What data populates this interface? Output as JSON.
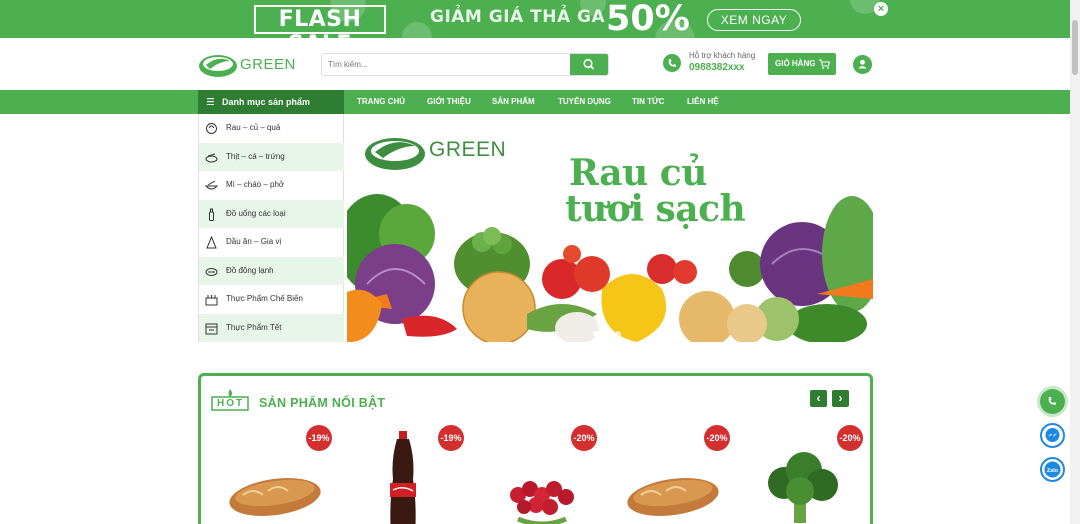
{
  "promo": {
    "flash_label": "FLASH SALE",
    "text": "GIẢM GIÁ THẢ GA",
    "percent": "50%",
    "button": "XEM NGAY",
    "close": "×",
    "colors": {
      "bg": "#4caf50"
    }
  },
  "header": {
    "logo_text": "GREEN",
    "search_placeholder": "Tìm kiếm...",
    "support_label": "Hỗ trợ khách hàng",
    "support_phone": "0988382xxx",
    "cart_label": "GIỎ HÀNG"
  },
  "nav": {
    "category_header": "Danh mục sản phẩm",
    "items": [
      "TRANG CHỦ",
      "GIỚI THIỆU",
      "SẢN PHẨM",
      "TUYỂN DỤNG",
      "TIN TỨC",
      "LIÊN HỆ"
    ]
  },
  "categories": [
    {
      "label": "Rau – củ – quả",
      "icon": "vegetable-icon"
    },
    {
      "label": "Thịt – cá – trứng",
      "icon": "meat-icon"
    },
    {
      "label": "Mì – cháo – phở",
      "icon": "noodle-icon"
    },
    {
      "label": "Đồ uống các loại",
      "icon": "drink-icon"
    },
    {
      "label": "Dầu ăn – Gia vị",
      "icon": "oil-icon"
    },
    {
      "label": "Đồ đông lạnh",
      "icon": "frozen-icon"
    },
    {
      "label": "Thực Phẩm Chế Biến",
      "icon": "processed-food-icon"
    },
    {
      "label": "Thực Phẩm Tết",
      "icon": "tet-food-icon"
    }
  ],
  "hero": {
    "logo_text": "GREEN",
    "line1": "Rau củ",
    "line2": "tươi sạch"
  },
  "featured": {
    "badge": "HOT",
    "title": "SẢN PHẨM NỔI BẬT",
    "prev": "‹",
    "next": "›",
    "products": [
      {
        "discount": "-19%",
        "image": "bread"
      },
      {
        "discount": "-19%",
        "image": "coca-cola-bottle"
      },
      {
        "discount": "-20%",
        "image": "cherries"
      },
      {
        "discount": "-20%",
        "image": "bread"
      },
      {
        "discount": "-20%",
        "image": "broccoli"
      }
    ]
  },
  "floating": [
    "phone-icon",
    "messenger-icon",
    "zalo-icon"
  ],
  "colors": {
    "primary": "#4caf50",
    "dark": "#2e7d32",
    "badge": "#d32f2f",
    "alt_row": "#e8f5e9"
  }
}
